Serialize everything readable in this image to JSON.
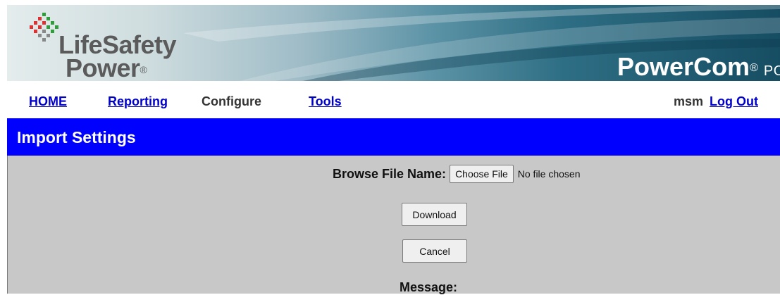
{
  "brand": {
    "logo_line1": "LifeSafety",
    "logo_line2": "Power",
    "logo_mark": "®",
    "product_name": "PowerCom",
    "product_mark": "®",
    "product_tail": "POWE"
  },
  "nav": {
    "items": [
      {
        "label": "HOME"
      },
      {
        "label": "Reporting"
      },
      {
        "label": "Configure"
      },
      {
        "label": "Tools"
      }
    ],
    "username": "msm",
    "logout_label": "Log Out"
  },
  "page": {
    "title": "Import Settings"
  },
  "form": {
    "browse_label": "Browse File Name:",
    "choose_file_label": "Choose File",
    "file_status": "No file chosen",
    "download_label": "Download",
    "cancel_label": "Cancel",
    "message_label": "Message:"
  },
  "colors": {
    "title_bar": "#0000ff",
    "link": "#0000cc",
    "content_bg": "#c8c8c8",
    "logo_red": "#e03030",
    "logo_green": "#2f9e3a"
  },
  "icons": {
    "logo": "pixel-dots-logo-icon"
  }
}
